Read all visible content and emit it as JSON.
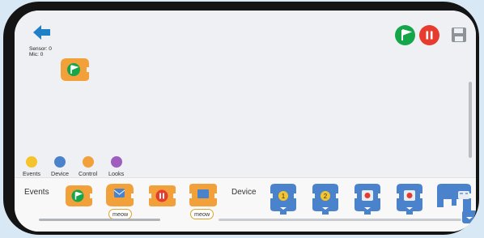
{
  "readouts": {
    "sensor": "Sensor: 0",
    "mic": "Mic: 0"
  },
  "categories": [
    {
      "label": "Events",
      "color": "#f5c42c"
    },
    {
      "label": "Device",
      "color": "#4a82cc"
    },
    {
      "label": "Control",
      "color": "#f2a03a"
    },
    {
      "label": "Looks",
      "color": "#a05cbf"
    }
  ],
  "palette": {
    "events_label": "Events",
    "device_label": "Device",
    "meow_1": "meow",
    "meow_2": "meow",
    "device_badges": [
      "1",
      "2"
    ]
  },
  "colors": {
    "events": "#f2a03a",
    "device": "#4a82cc",
    "go": "#16a64a",
    "stop": "#e63b2e"
  }
}
